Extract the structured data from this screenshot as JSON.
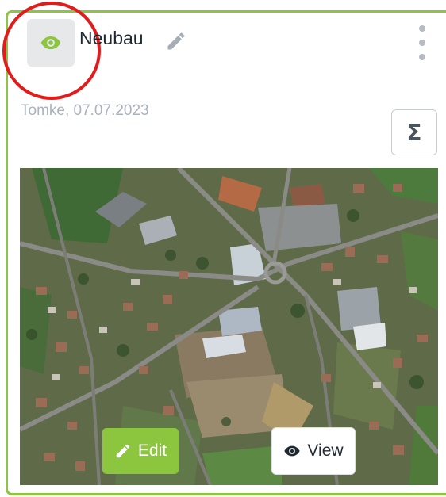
{
  "card": {
    "title": "Neubau",
    "meta": "Tomke, 07.07.2023",
    "sigma_label": "Σ",
    "accent_color": "#8cc63f"
  },
  "icons": {
    "visibility": "eye-icon",
    "rename": "pencil-icon",
    "menu": "kebab-menu-icon",
    "summary": "sigma-icon"
  },
  "actions": {
    "edit_label": "Edit",
    "view_label": "View"
  },
  "annotation": {
    "highlight_color": "#e31b1b"
  }
}
